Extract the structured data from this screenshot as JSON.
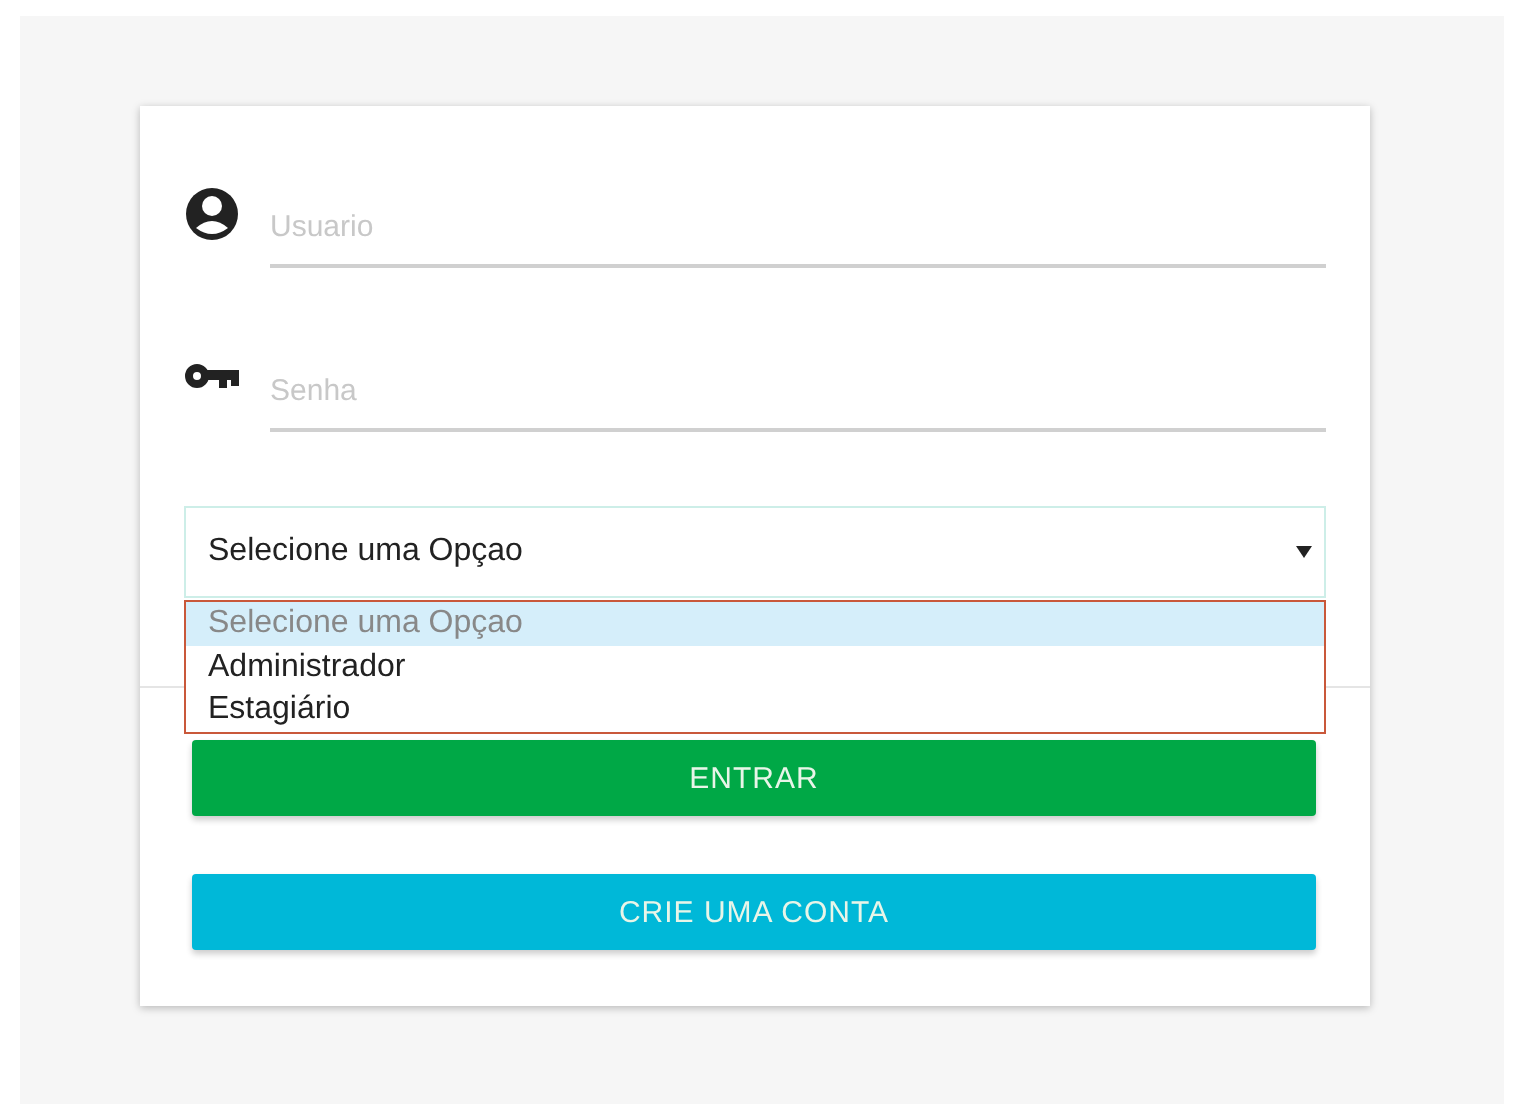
{
  "fields": [
    {
      "kind": "user",
      "placeholder": "Usuario"
    },
    {
      "kind": "password",
      "placeholder": "Senha"
    }
  ],
  "select": {
    "value": "Selecione uma Opçao",
    "expanded": true,
    "options": [
      {
        "label": "Selecione uma Opçao",
        "selected": true
      },
      {
        "label": "Administrador",
        "selected": false
      },
      {
        "label": "Estagiário",
        "selected": false
      }
    ]
  },
  "buttons": [
    {
      "label": "ENTRAR",
      "kind": "primary"
    },
    {
      "label": "CRIE UMA CONTA",
      "kind": "secondary"
    }
  ]
}
